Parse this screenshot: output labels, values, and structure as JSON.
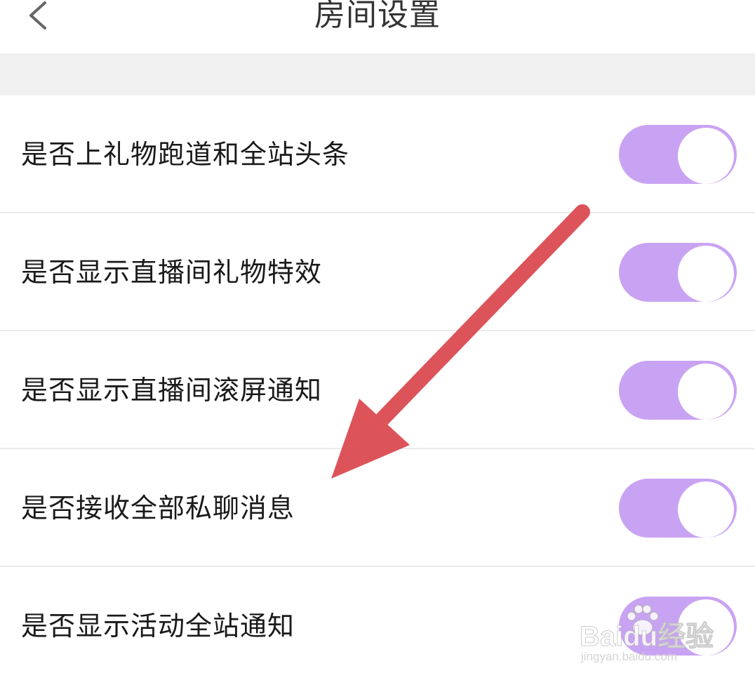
{
  "header": {
    "title": "房间设置",
    "back_icon": "chevron-left-icon"
  },
  "colors": {
    "toggle_on": "#c9a3f3",
    "toggle_knob": "#ffffff",
    "arrow": "#dc545a",
    "divider": "#ebebeb",
    "band": "#f0f0f0"
  },
  "settings": [
    {
      "label": "是否上礼物跑道和全站头条",
      "enabled": true
    },
    {
      "label": "是否显示直播间礼物特效",
      "enabled": true
    },
    {
      "label": "是否显示直播间滚屏通知",
      "enabled": true
    },
    {
      "label": "是否接收全部私聊消息",
      "enabled": true
    },
    {
      "label": "是否显示活动全站通知",
      "enabled": true
    }
  ],
  "watermark": {
    "brand": "Baidu经验",
    "url": "jingyan.baidu.com"
  }
}
